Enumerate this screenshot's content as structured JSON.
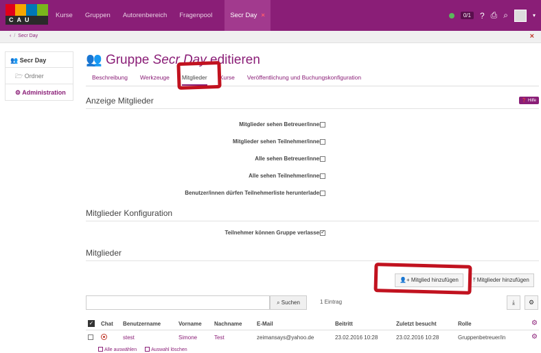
{
  "brand": {
    "logo_text": "CAU"
  },
  "nav": {
    "items": [
      "Kurse",
      "Gruppen",
      "Autorenbereich",
      "Fragenpool"
    ],
    "active": "Secr Day",
    "active_close": "×"
  },
  "topright": {
    "counter": "0/1"
  },
  "breadcrumb": {
    "back": "‹",
    "label": "Secr Day",
    "close": "×"
  },
  "sidebar": {
    "title": "Secr Day",
    "items": [
      "Ordner",
      "Administration"
    ]
  },
  "page": {
    "title_prefix": "Gruppe",
    "title_name": "Secr Day",
    "title_suffix": "editieren"
  },
  "tabs": [
    "Beschreibung",
    "Werkzeuge",
    "Mitglieder",
    "Kurse",
    "Veröffentlichung und Buchungskonfiguration"
  ],
  "sections": {
    "display": "Anzeige Mitglieder",
    "help": "Hilfe",
    "config": "Mitglieder Konfiguration",
    "members": "Mitglieder"
  },
  "display_options": [
    {
      "label": "Mitglieder sehen Betreuer/innen",
      "checked": false
    },
    {
      "label": "Mitglieder sehen Teilnehmer/innen",
      "checked": false
    },
    {
      "label": "Alle sehen Betreuer/innen",
      "checked": false
    },
    {
      "label": "Alle sehen Teilnehmer/innen",
      "checked": false
    },
    {
      "label": "Benutzer/innen dürfen Teilnehmerliste herunterladen",
      "checked": false
    }
  ],
  "config_options": [
    {
      "label": "Teilnehmer können Gruppe verlassen",
      "checked": true
    }
  ],
  "buttons": {
    "add_member": "Mitglied hinzufügen",
    "add_members": "Mitglieder hinzufügen",
    "search": "Suchen"
  },
  "search": {
    "value": "",
    "entries": "1 Eintrag"
  },
  "table": {
    "headers": [
      "Chat",
      "Benutzername",
      "Vorname",
      "Nachname",
      "E-Mail",
      "Beitritt",
      "Zuletzt besucht",
      "Rolle"
    ],
    "rows": [
      {
        "username": "stest",
        "first": "Simone",
        "last": "Test",
        "email": "zeimansays@yahoo.de",
        "joined": "23.02.2016 10:28",
        "last_visit": "23.02.2016 10:28",
        "role": "Gruppenbetreuer/in"
      }
    ]
  },
  "footer": {
    "select_all": "Alle auswählen",
    "clear_selection": "Auswahl löschen"
  },
  "colors": {
    "brand": "#8a1e77",
    "annotation": "#c1121f"
  }
}
